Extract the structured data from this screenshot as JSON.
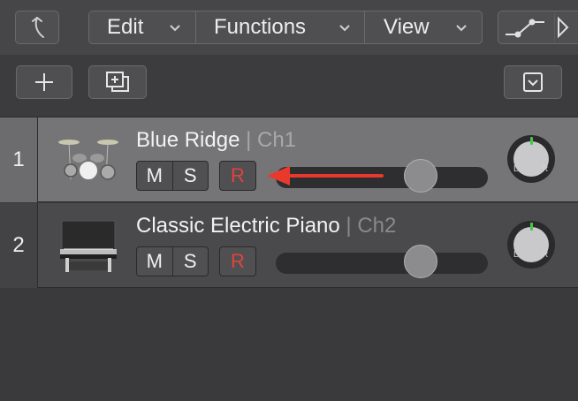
{
  "toolbar": {
    "menus": [
      "Edit",
      "Functions",
      "View"
    ],
    "back_icon": "back-arrow-icon",
    "automation_icon": "automation-curve-icon"
  },
  "track_toolbar": {
    "add_icon": "plus-icon",
    "duplicate_icon": "duplicate-track-icon",
    "collapse_icon": "collapse-chevron-icon"
  },
  "tracks": [
    {
      "number": "1",
      "name": "Blue Ridge",
      "channel": "| Ch1",
      "mute": "M",
      "solo": "S",
      "record": "R",
      "volume": 0.72,
      "pan_left": "L",
      "pan_right": "R",
      "selected": true
    },
    {
      "number": "2",
      "name": "Classic Electric Piano",
      "channel": "| Ch2",
      "mute": "M",
      "solo": "S",
      "record": "R",
      "volume": 0.72,
      "pan_left": "L",
      "pan_right": "R",
      "selected": false
    }
  ],
  "colors": {
    "record_red": "#e0443a",
    "annotation_arrow": "#e8392c",
    "pan_green": "#45c84a"
  }
}
